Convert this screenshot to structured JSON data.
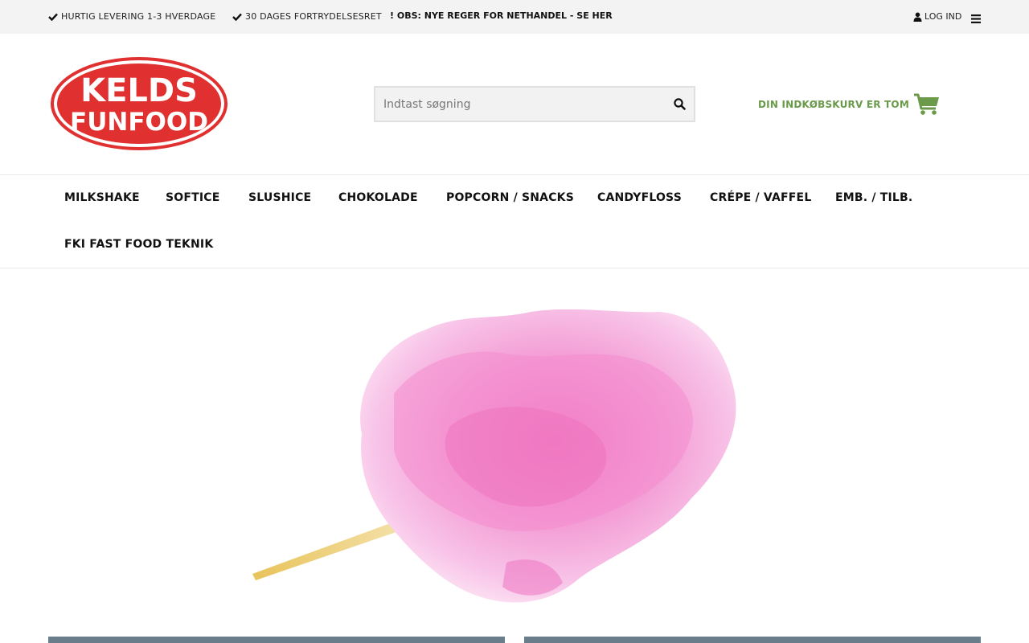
{
  "topbar": {
    "benefit_1": "HURTIG LEVERING 1-3 HVERDAGE",
    "benefit_2": "30 DAGES FORTRYDELSESRET",
    "notice": "! OBS: NYE REGER FOR NETHANDEL - SE HER",
    "login": "LOG IND",
    "icons": [
      "check-icon",
      "user-icon",
      "menu-icon"
    ]
  },
  "header": {
    "logo": {
      "line1": "KELDS",
      "line2": "FUNFOOD"
    },
    "search": {
      "placeholder": "Indtast søgning",
      "value": ""
    },
    "cart": {
      "label": "DIN INDKØBSKURV ER TOM",
      "icon": "cart-icon"
    }
  },
  "nav": {
    "items": [
      {
        "label": "MILKSHAKE"
      },
      {
        "label": "SOFTICE"
      },
      {
        "label": "SLUSHICE"
      },
      {
        "label": "CHOKOLADE"
      },
      {
        "label": "POPCORN / SNACKS"
      },
      {
        "label": "CANDYFLOSS"
      },
      {
        "label": "CRÉPE / VAFFEL"
      },
      {
        "label": "EMB. / TILB."
      },
      {
        "label": "FKI FAST FOOD TEKNIK"
      }
    ]
  },
  "colors": {
    "brand_red": "#e0302f",
    "cart_green": "#6a9a4a",
    "topbar_bg": "#f3f3f3",
    "card_bar": "#6a7d8a"
  }
}
